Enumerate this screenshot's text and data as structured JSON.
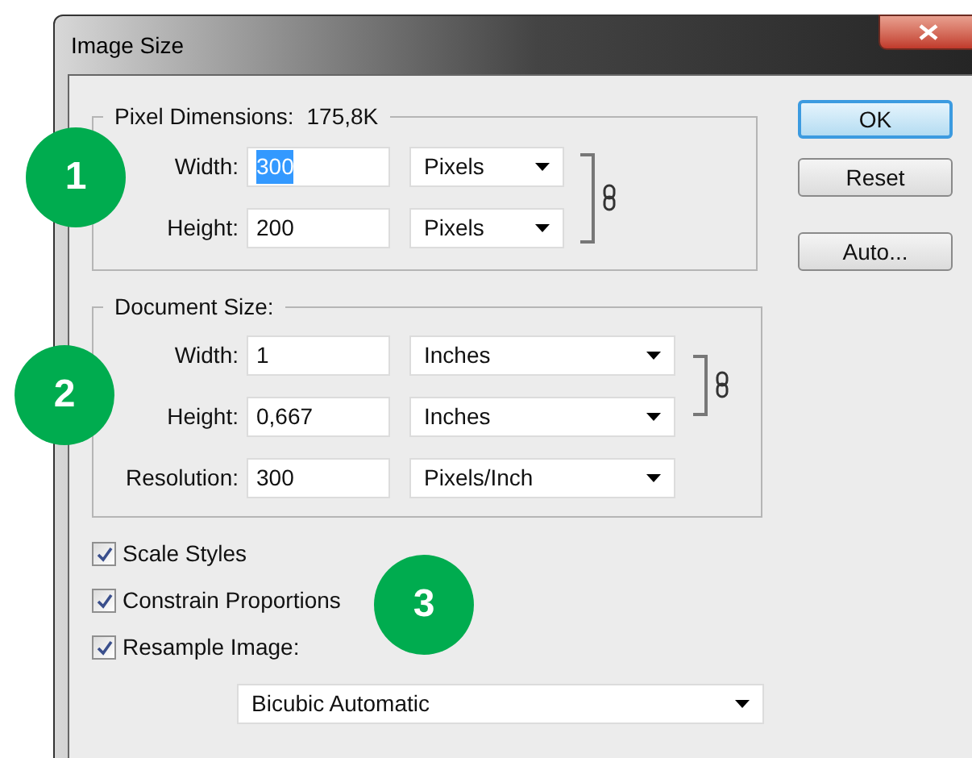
{
  "window": {
    "title": "Image Size"
  },
  "pixel_dimensions": {
    "legend": "Pixel Dimensions:",
    "value": "175,8K",
    "linked": true,
    "rows": [
      {
        "label": "Width:",
        "value": "300",
        "text_selected": true,
        "unit": "Pixels"
      },
      {
        "label": "Height:",
        "value": "200",
        "text_selected": false,
        "unit": "Pixels"
      }
    ]
  },
  "document_size": {
    "legend": "Document Size:",
    "linked": true,
    "rows": [
      {
        "label": "Width:",
        "value": "1",
        "unit": "Inches"
      },
      {
        "label": "Height:",
        "value": "0,667",
        "unit": "Inches"
      },
      {
        "label": "Resolution:",
        "value": "300",
        "unit": "Pixels/Inch"
      }
    ]
  },
  "options": [
    {
      "label": "Scale Styles",
      "checked": true
    },
    {
      "label": "Constrain Proportions",
      "checked": true
    },
    {
      "label": "Resample Image:",
      "checked": true
    }
  ],
  "resample_method": "Bicubic Automatic",
  "buttons": [
    {
      "label": "OK",
      "default": true
    },
    {
      "label": "Reset",
      "default": false
    },
    {
      "label": "Auto...",
      "default": false
    }
  ],
  "badges": [
    "1",
    "2",
    "3"
  ]
}
